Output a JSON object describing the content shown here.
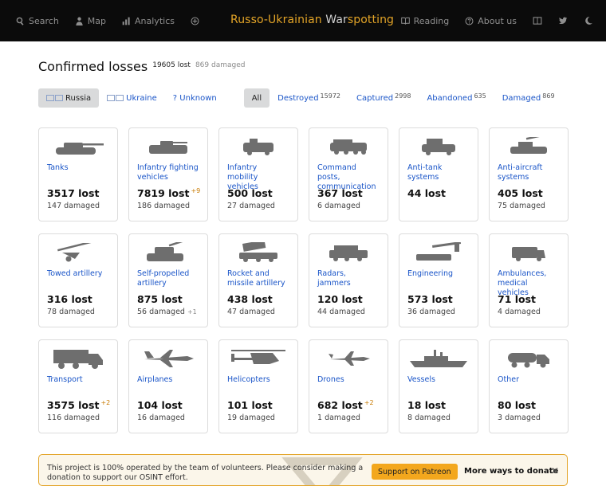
{
  "nav": {
    "search": "Search",
    "map": "Map",
    "analytics": "Analytics",
    "brand_prefix": "Russo-Ukrainian ",
    "brand_war": "War",
    "brand_suffix": "spotting",
    "reading": "Reading",
    "about": "About us"
  },
  "header": {
    "title": "Confirmed losses",
    "lost": "19605 lost",
    "damaged": "869 damaged"
  },
  "filters": {
    "russia": "Russia",
    "ukraine": "Ukraine",
    "unknown": "? Unknown",
    "all": "All",
    "destroyed": "Destroyed",
    "destroyed_count": "15972",
    "captured": "Captured",
    "captured_count": "2998",
    "abandoned": "Abandoned",
    "abandoned_count": "635",
    "damaged": "Damaged",
    "damaged_count": "869"
  },
  "categories": [
    {
      "label": "Tanks",
      "lost": "3517 lost",
      "inc": "",
      "damaged": "147 damaged",
      "dinc": "",
      "icon": "tank-icon"
    },
    {
      "label": "Infantry fighting vehicles",
      "lost": "7819 lost",
      "inc": "+9",
      "damaged": "186 damaged",
      "dinc": "",
      "icon": "ifv-icon"
    },
    {
      "label": "Infantry mobility vehicles",
      "lost": "500 lost",
      "inc": "",
      "damaged": "27 damaged",
      "dinc": "",
      "icon": "imv-icon"
    },
    {
      "label": "Command posts, communication",
      "lost": "367 lost",
      "inc": "",
      "damaged": "6 damaged",
      "dinc": "",
      "icon": "command-post-icon"
    },
    {
      "label": "Anti-tank systems",
      "lost": "44 lost",
      "inc": "",
      "damaged": "",
      "dinc": "",
      "icon": "anti-tank-icon"
    },
    {
      "label": "Anti-aircraft systems",
      "lost": "405 lost",
      "inc": "",
      "damaged": "75 damaged",
      "dinc": "",
      "icon": "anti-aircraft-icon"
    },
    {
      "label": "Towed artillery",
      "lost": "316 lost",
      "inc": "",
      "damaged": "78 damaged",
      "dinc": "",
      "icon": "towed-artillery-icon"
    },
    {
      "label": "Self-propelled artillery",
      "lost": "875 lost",
      "inc": "",
      "damaged": "56 damaged",
      "dinc": "+1",
      "icon": "spg-icon"
    },
    {
      "label": "Rocket and missile artillery",
      "lost": "438 lost",
      "inc": "",
      "damaged": "47 damaged",
      "dinc": "",
      "icon": "rocket-artillery-icon"
    },
    {
      "label": "Radars, jammers",
      "lost": "120 lost",
      "inc": "",
      "damaged": "44 damaged",
      "dinc": "",
      "icon": "radar-icon"
    },
    {
      "label": "Engineering",
      "lost": "573 lost",
      "inc": "",
      "damaged": "36 damaged",
      "dinc": "",
      "icon": "engineering-icon"
    },
    {
      "label": "Ambulances, medical vehicles",
      "lost": "71 lost",
      "inc": "",
      "damaged": "4 damaged",
      "dinc": "",
      "icon": "ambulance-icon"
    },
    {
      "label": "Transport",
      "lost": "3575 lost",
      "inc": "+2",
      "damaged": "116 damaged",
      "dinc": "",
      "icon": "truck-icon"
    },
    {
      "label": "Airplanes",
      "lost": "104 lost",
      "inc": "",
      "damaged": "16 damaged",
      "dinc": "",
      "icon": "airplane-icon"
    },
    {
      "label": "Helicopters",
      "lost": "101 lost",
      "inc": "",
      "damaged": "19 damaged",
      "dinc": "",
      "icon": "helicopter-icon"
    },
    {
      "label": "Drones",
      "lost": "682 lost",
      "inc": "+2",
      "damaged": "1 damaged",
      "dinc": "",
      "icon": "drone-icon"
    },
    {
      "label": "Vessels",
      "lost": "18 lost",
      "inc": "",
      "damaged": "8 damaged",
      "dinc": "",
      "icon": "vessel-icon"
    },
    {
      "label": "Other",
      "lost": "80 lost",
      "inc": "",
      "damaged": "3 damaged",
      "dinc": "",
      "icon": "tanker-truck-icon"
    }
  ],
  "banner": {
    "text": "This project is 100% operated by the team of volunteers. Please consider making a donation to support our OSINT effort.",
    "patreon": "Support on Patreon",
    "more": "More ways to donate",
    "close": "✕"
  },
  "colors": {
    "topbar": "#0b0b0b",
    "brand": "#e3a427",
    "link": "#1a55c8",
    "banner_border": "#e3a427",
    "patreon": "#f3a71d"
  }
}
